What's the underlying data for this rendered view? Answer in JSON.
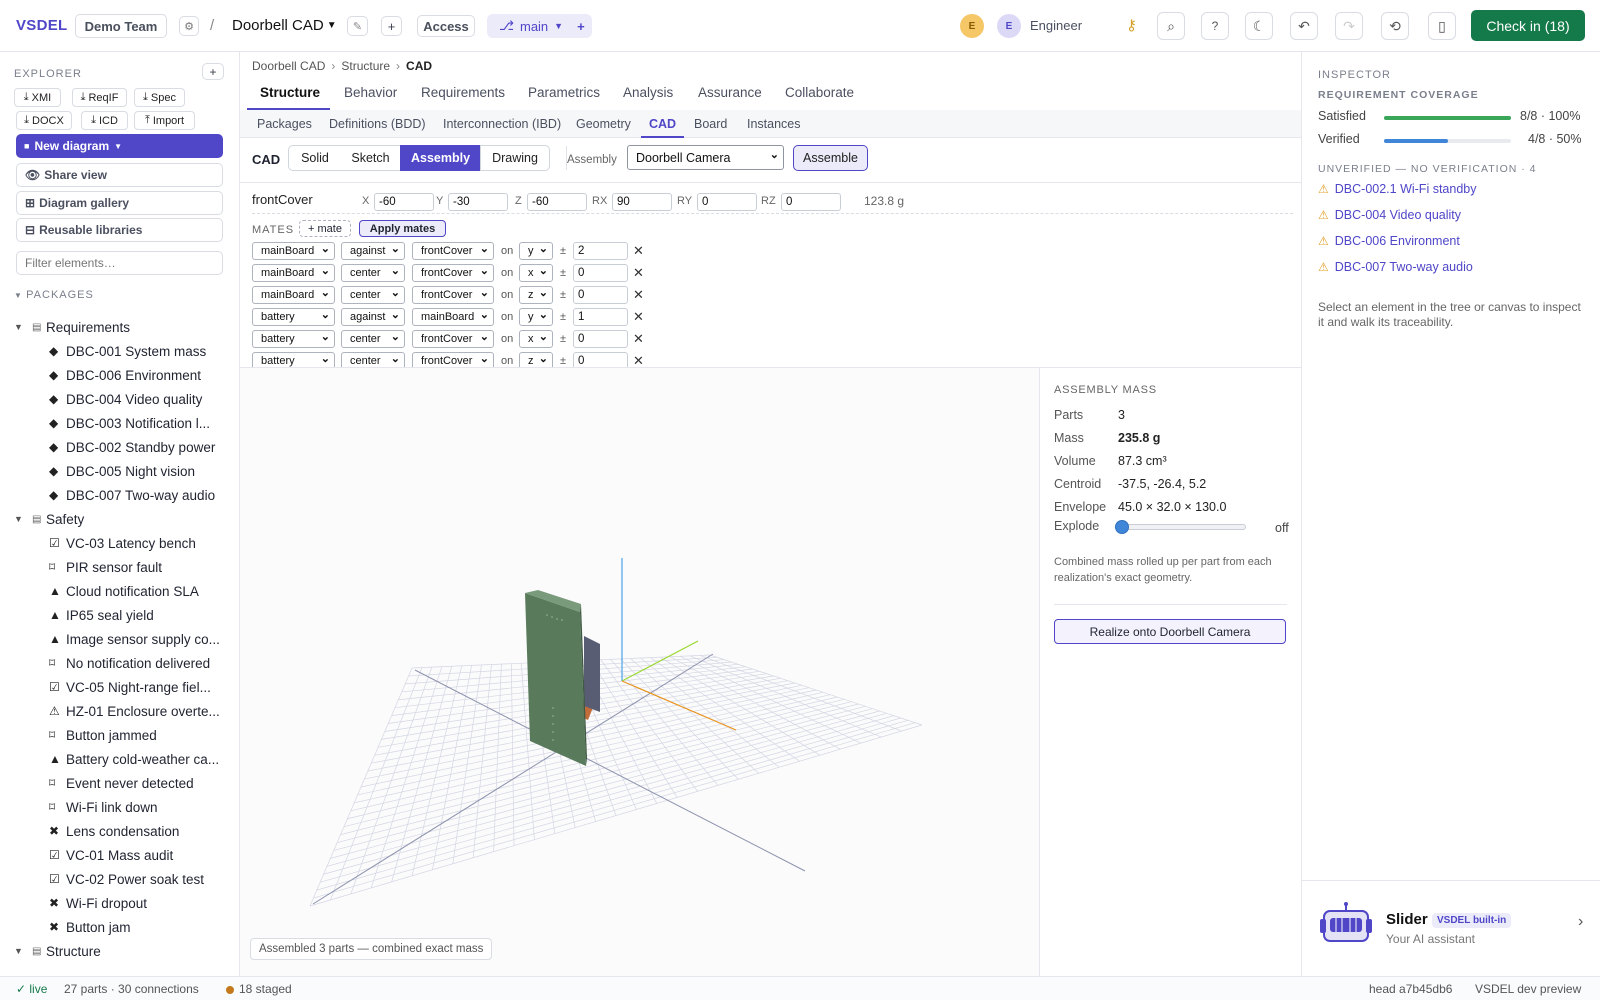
{
  "topbar": {
    "logo": "VSDEL",
    "team": "Demo Team",
    "gear_icon": "gear-icon",
    "separator": "/",
    "project": "Doorbell CAD",
    "access": "Access",
    "branch": "main",
    "branch_add": "+",
    "plus": "+",
    "pencil": "✎",
    "avatar1": "E",
    "avatar2": "E",
    "role": "Engineer",
    "checkin": "Check in (18)"
  },
  "explorer": {
    "title": "EXPLORER",
    "add": "+",
    "export_buttons": [
      "XMI",
      "ReqIF",
      "Spec",
      "DOCX",
      "ICD",
      "Import"
    ],
    "new_diagram": "New diagram",
    "share_view": "Share view",
    "diagram_gallery": "Diagram gallery",
    "reusable_libraries": "Reusable libraries",
    "filter_placeholder": "Filter elements…",
    "packages_label": "PACKAGES",
    "tree": [
      {
        "level": 0,
        "glyph": "▤",
        "label": "Requirements",
        "twisty": "▼"
      },
      {
        "level": 1,
        "glyph": "◆",
        "label": "DBC-001 System mass"
      },
      {
        "level": 1,
        "glyph": "◆",
        "label": "DBC-006 Environment"
      },
      {
        "level": 1,
        "glyph": "◆",
        "label": "DBC-004 Video quality"
      },
      {
        "level": 1,
        "glyph": "◆",
        "label": "DBC-003 Notification l..."
      },
      {
        "level": 1,
        "glyph": "◆",
        "label": "DBC-002 Standby power"
      },
      {
        "level": 1,
        "glyph": "◆",
        "label": "DBC-005 Night vision"
      },
      {
        "level": 1,
        "glyph": "◆",
        "label": "DBC-007 Two-way audio"
      },
      {
        "level": 0,
        "glyph": "▤",
        "label": "Safety",
        "twisty": "▼"
      },
      {
        "level": 1,
        "glyph": "☑",
        "label": "VC-03 Latency bench"
      },
      {
        "level": 1,
        "glyph": "⌑",
        "label": "PIR sensor fault"
      },
      {
        "level": 1,
        "glyph": "▲",
        "label": "Cloud notification SLA"
      },
      {
        "level": 1,
        "glyph": "▲",
        "label": "IP65 seal yield"
      },
      {
        "level": 1,
        "glyph": "▲",
        "label": "Image sensor supply co..."
      },
      {
        "level": 1,
        "glyph": "⌑",
        "label": "No notification delivered"
      },
      {
        "level": 1,
        "glyph": "☑",
        "label": "VC-05 Night-range fiel..."
      },
      {
        "level": 1,
        "glyph": "⚠",
        "label": "HZ-01 Enclosure overte..."
      },
      {
        "level": 1,
        "glyph": "⌑",
        "label": "Button jammed"
      },
      {
        "level": 1,
        "glyph": "▲",
        "label": "Battery cold-weather ca..."
      },
      {
        "level": 1,
        "glyph": "⌑",
        "label": "Event never detected"
      },
      {
        "level": 1,
        "glyph": "⌑",
        "label": "Wi-Fi link down"
      },
      {
        "level": 1,
        "glyph": "✖",
        "label": "Lens condensation"
      },
      {
        "level": 1,
        "glyph": "☑",
        "label": "VC-01 Mass audit"
      },
      {
        "level": 1,
        "glyph": "☑",
        "label": "VC-02 Power soak test"
      },
      {
        "level": 1,
        "glyph": "✖",
        "label": "Wi-Fi dropout"
      },
      {
        "level": 1,
        "glyph": "✖",
        "label": "Button jam"
      },
      {
        "level": 0,
        "glyph": "▤",
        "label": "Structure",
        "twisty": "▼"
      }
    ]
  },
  "breadcrumb": [
    "Doorbell CAD",
    "Structure",
    "CAD"
  ],
  "tabs": [
    "Structure",
    "Behavior",
    "Requirements",
    "Parametrics",
    "Analysis",
    "Assurance",
    "Collaborate"
  ],
  "subtabs": [
    "Packages",
    "Definitions (BDD)",
    "Interconnection (IBD)",
    "Geometry",
    "CAD",
    "Board",
    "Instances"
  ],
  "cad": {
    "label": "CAD",
    "modes": [
      "Solid",
      "Sketch",
      "Assembly",
      "Drawing"
    ],
    "assembly_label": "Assembly",
    "assembly_value": "Doorbell Camera",
    "assemble": "Assemble",
    "part": "frontCover",
    "transform": [
      {
        "k": "X",
        "v": "-60"
      },
      {
        "k": "Y",
        "v": "-30"
      },
      {
        "k": "Z",
        "v": "-60"
      },
      {
        "k": "RX",
        "v": "90"
      },
      {
        "k": "RY",
        "v": "0"
      },
      {
        "k": "RZ",
        "v": "0"
      }
    ],
    "part_mass": "123.8 g",
    "mates_label": "MATES",
    "add_mate": "+ mate",
    "apply_mates": "Apply mates",
    "mates": [
      {
        "a": "mainBoard",
        "rel": "against",
        "b": "frontCover",
        "axis": "y",
        "val": "2"
      },
      {
        "a": "mainBoard",
        "rel": "center",
        "b": "frontCover",
        "axis": "x",
        "val": "0"
      },
      {
        "a": "mainBoard",
        "rel": "center",
        "b": "frontCover",
        "axis": "z",
        "val": "0"
      },
      {
        "a": "battery",
        "rel": "against",
        "b": "mainBoard",
        "axis": "y",
        "val": "1"
      },
      {
        "a": "battery",
        "rel": "center",
        "b": "frontCover",
        "axis": "x",
        "val": "0"
      },
      {
        "a": "battery",
        "rel": "center",
        "b": "frontCover",
        "axis": "z",
        "val": "0"
      }
    ],
    "on": "on",
    "pm": "±",
    "viewport_status": "Assembled 3 parts — combined exact mass"
  },
  "assembly_mass": {
    "title": "ASSEMBLY MASS",
    "rows": [
      {
        "k": "Parts",
        "v": "3"
      },
      {
        "k": "Mass",
        "v": "235.8 g"
      },
      {
        "k": "Volume",
        "v": "87.3 cm³"
      },
      {
        "k": "Centroid",
        "v": "-37.5, -26.4, 5.2"
      },
      {
        "k": "Envelope",
        "v": "45.0 × 32.0 × 130.0"
      }
    ],
    "explode_label": "Explode",
    "explode_value": 0,
    "explode_state": "off",
    "note": "Combined mass rolled up per part from each realization's exact geometry.",
    "realize": "Realize onto Doorbell Camera"
  },
  "inspector": {
    "title": "INSPECTOR",
    "coverage_title": "REQUIREMENT COVERAGE",
    "satisfied_label": "Satisfied",
    "satisfied_value": "8/8 · 100%",
    "satisfied_fraction": 1.0,
    "verified_label": "Verified",
    "verified_value": "4/8 · 50%",
    "verified_fraction": 0.5,
    "unverified_title": "UNVERIFIED — NO VERIFICATION · 4",
    "unverified": [
      "DBC-002.1 Wi-Fi standby",
      "DBC-004 Video quality",
      "DBC-006 Environment",
      "DBC-007 Two-way audio"
    ],
    "hint": "Select an element in the tree or canvas to inspect it and walk its traceability."
  },
  "assistant": {
    "name": "Slider",
    "badge": "VSDEL built-in",
    "subtitle": "Your AI assistant",
    "chevron": "›"
  },
  "status": {
    "live": "✓ live",
    "counts": "27 parts · 30 connections",
    "staged": "18 staged",
    "head": "head a7b45db6",
    "build": "VSDEL dev preview"
  },
  "colors": {
    "accent": "#4f46c8",
    "checkin": "#157a4a",
    "satisfied": "#3aa65a",
    "verified": "#3f86d8",
    "warning": "#e2a12b",
    "board": "#5a7a5c"
  }
}
